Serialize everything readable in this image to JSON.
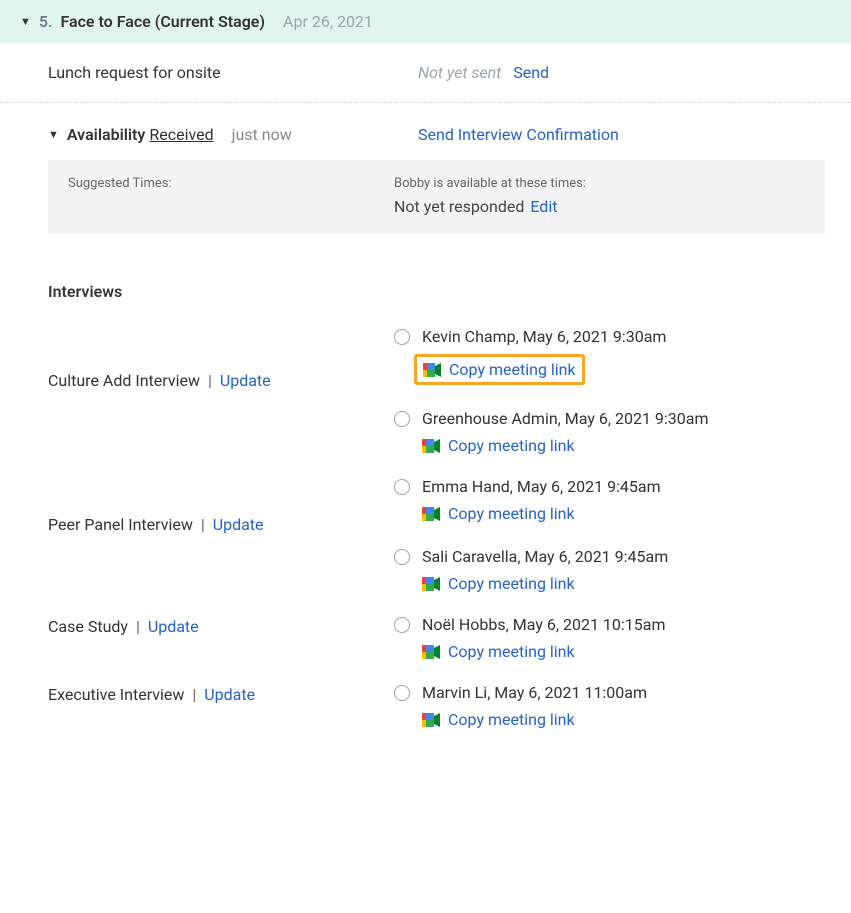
{
  "stage": {
    "number": "5.",
    "title": "Face to Face (Current Stage)",
    "date": "Apr 26, 2021"
  },
  "lunch": {
    "label": "Lunch request for onsite",
    "status": "Not yet sent",
    "send": "Send"
  },
  "availability": {
    "label": "Availability",
    "status": "Received",
    "when": "just now",
    "action": "Send Interview Confirmation"
  },
  "suggested": {
    "left_label": "Suggested Times:",
    "hint": "Bobby is available at these times:",
    "status": "Not yet responded",
    "edit": "Edit"
  },
  "interviews_heading": "Interviews",
  "copy_link_label": "Copy meeting link",
  "update_label": "Update",
  "interviews": [
    {
      "name": "Culture Add Interview",
      "slots": [
        {
          "label": "Kevin Champ, May 6, 2021 9:30am",
          "highlighted": true
        },
        {
          "label": "Greenhouse Admin, May 6, 2021 9:30am",
          "highlighted": false
        }
      ]
    },
    {
      "name": "Peer Panel Interview",
      "slots": [
        {
          "label": "Emma Hand, May 6, 2021 9:45am",
          "highlighted": false
        },
        {
          "label": "Sali Caravella, May 6, 2021 9:45am",
          "highlighted": false
        }
      ]
    },
    {
      "name": "Case Study",
      "slots": [
        {
          "label": "Noël Hobbs, May 6, 2021 10:15am",
          "highlighted": false
        }
      ]
    },
    {
      "name": "Executive Interview",
      "slots": [
        {
          "label": "Marvin Li, May 6, 2021 11:00am",
          "highlighted": false
        }
      ]
    }
  ]
}
